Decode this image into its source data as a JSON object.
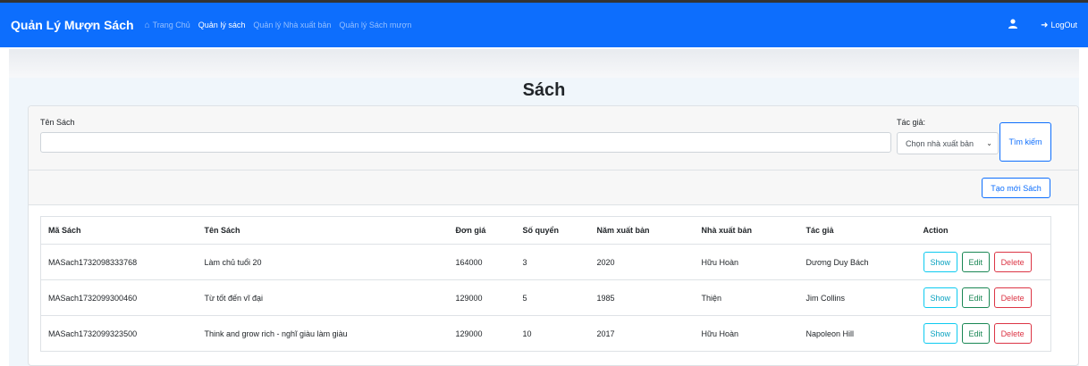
{
  "navbar": {
    "brand": "Quản Lý Mượn Sách",
    "links": [
      {
        "label": "Trang Chủ",
        "active": false
      },
      {
        "label": "Quản lý sách",
        "active": true
      },
      {
        "label": "Quản lý Nhà xuất bản",
        "active": false
      },
      {
        "label": "Quản lý Sách mượn",
        "active": false
      }
    ],
    "logout": "LogOut",
    "icons": {
      "home": "home-icon",
      "user": "user-icon",
      "logout": "logout-icon"
    }
  },
  "page": {
    "title": "Sách"
  },
  "search": {
    "name_label": "Tên Sách",
    "name_value": "",
    "author_label": "Tác giả:",
    "select_value": "Chọn nhà xuất bản",
    "search_button": "Tìm kiếm"
  },
  "toolbar": {
    "create_button": "Tạo mới Sách"
  },
  "table": {
    "headers": [
      "Mã Sách",
      "Tên Sách",
      "Đơn giá",
      "Số quyển",
      "Năm xuất bản",
      "Nhà xuất bản",
      "Tác giả",
      "Action"
    ],
    "rows": [
      [
        "MASach1732098333768",
        "Làm chủ tuổi 20",
        "164000",
        "3",
        "2020",
        "Hữu Hoàn",
        "Dương Duy Bách"
      ],
      [
        "MASach1732099300460",
        "Từ tốt đến vĩ đại",
        "129000",
        "5",
        "1985",
        "Thiện",
        "Jim Collins"
      ],
      [
        "MASach1732099323500",
        "Think and grow rich - nghĩ giàu làm giàu",
        "129000",
        "10",
        "2017",
        "Hữu Hoàn",
        "Napoleon Hill"
      ]
    ],
    "actions": {
      "show": "Show",
      "edit": "Edit",
      "delete": "Delete"
    }
  },
  "colors": {
    "primary": "#0d6efd",
    "info": "#0dcaf0",
    "success": "#198754",
    "danger": "#dc3545"
  }
}
